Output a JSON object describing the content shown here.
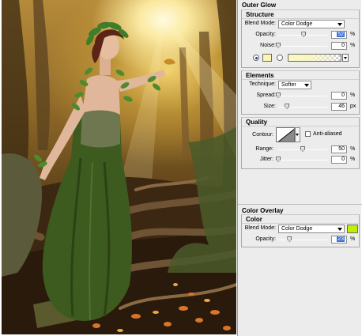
{
  "outer_glow": {
    "title": "Outer Glow",
    "structure": {
      "title": "Structure",
      "blend_mode_label": "Blend Mode:",
      "blend_mode_value": "Color Dodge",
      "opacity_label": "Opacity:",
      "opacity_value": "52",
      "opacity_unit": "%",
      "opacity_level": 0.52,
      "noise_label": "Noise:",
      "noise_value": "0",
      "noise_unit": "%",
      "noise_level": 0,
      "color_swatch": "#fbf5b4",
      "gradient_color": "#fbf7c2"
    },
    "elements": {
      "title": "Elements",
      "technique_label": "Technique:",
      "technique_value": "Softer",
      "spread_label": "Spread:",
      "spread_value": "0",
      "spread_unit": "%",
      "spread_level": 0,
      "size_label": "Size:",
      "size_value": "46",
      "size_unit": "px",
      "size_level": 0.18
    },
    "quality": {
      "title": "Quality",
      "contour_label": "Contour:",
      "anti_aliased_label": "Anti-aliased",
      "anti_aliased_checked": false,
      "range_label": "Range:",
      "range_value": "50",
      "range_unit": "%",
      "range_level": 0.5,
      "jitter_label": "Jitter:",
      "jitter_value": "0",
      "jitter_unit": "%",
      "jitter_level": 0
    }
  },
  "color_overlay": {
    "title": "Color Overlay",
    "color": {
      "title": "Color",
      "blend_mode_label": "Blend Mode:",
      "blend_mode_value": "Color Dodge",
      "swatch": "#bff000",
      "opacity_label": "Opacity:",
      "opacity_value": "23",
      "opacity_unit": "%",
      "opacity_level": 0.23
    }
  },
  "icons": [
    "radio-solid-color-icon",
    "radio-gradient-icon",
    "dropdown-arrow-icon",
    "contour-curve-icon",
    "checkbox-icon"
  ]
}
